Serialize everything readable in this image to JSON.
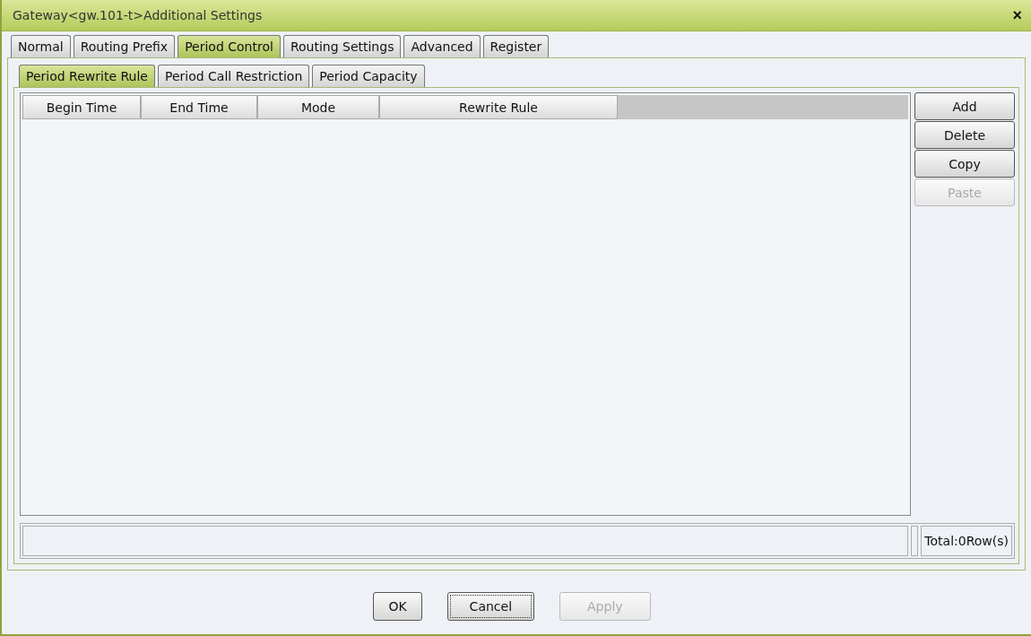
{
  "window": {
    "title": "Gateway<gw.101-t>Additional Settings",
    "close": "×"
  },
  "tabs": [
    {
      "label": "Normal",
      "selected": false
    },
    {
      "label": "Routing Prefix",
      "selected": false
    },
    {
      "label": "Period Control",
      "selected": true
    },
    {
      "label": "Routing Settings",
      "selected": false
    },
    {
      "label": "Advanced",
      "selected": false
    },
    {
      "label": "Register",
      "selected": false
    }
  ],
  "subtabs": [
    {
      "label": "Period Rewrite Rule",
      "selected": true
    },
    {
      "label": "Period Call Restriction",
      "selected": false
    },
    {
      "label": "Period Capacity",
      "selected": false
    }
  ],
  "table": {
    "columns": [
      "Begin Time",
      "End Time",
      "Mode",
      "Rewrite Rule"
    ]
  },
  "side_buttons": [
    {
      "label": "Add",
      "disabled": false
    },
    {
      "label": "Delete",
      "disabled": false
    },
    {
      "label": "Copy",
      "disabled": false
    },
    {
      "label": "Paste",
      "disabled": true
    }
  ],
  "status_bar": {
    "total": "Total:0Row(s)"
  },
  "buttons": [
    {
      "label": "OK",
      "disabled": false,
      "focused": false
    },
    {
      "label": "Cancel",
      "disabled": false,
      "focused": true
    },
    {
      "label": "Apply",
      "disabled": true,
      "focused": false
    }
  ]
}
